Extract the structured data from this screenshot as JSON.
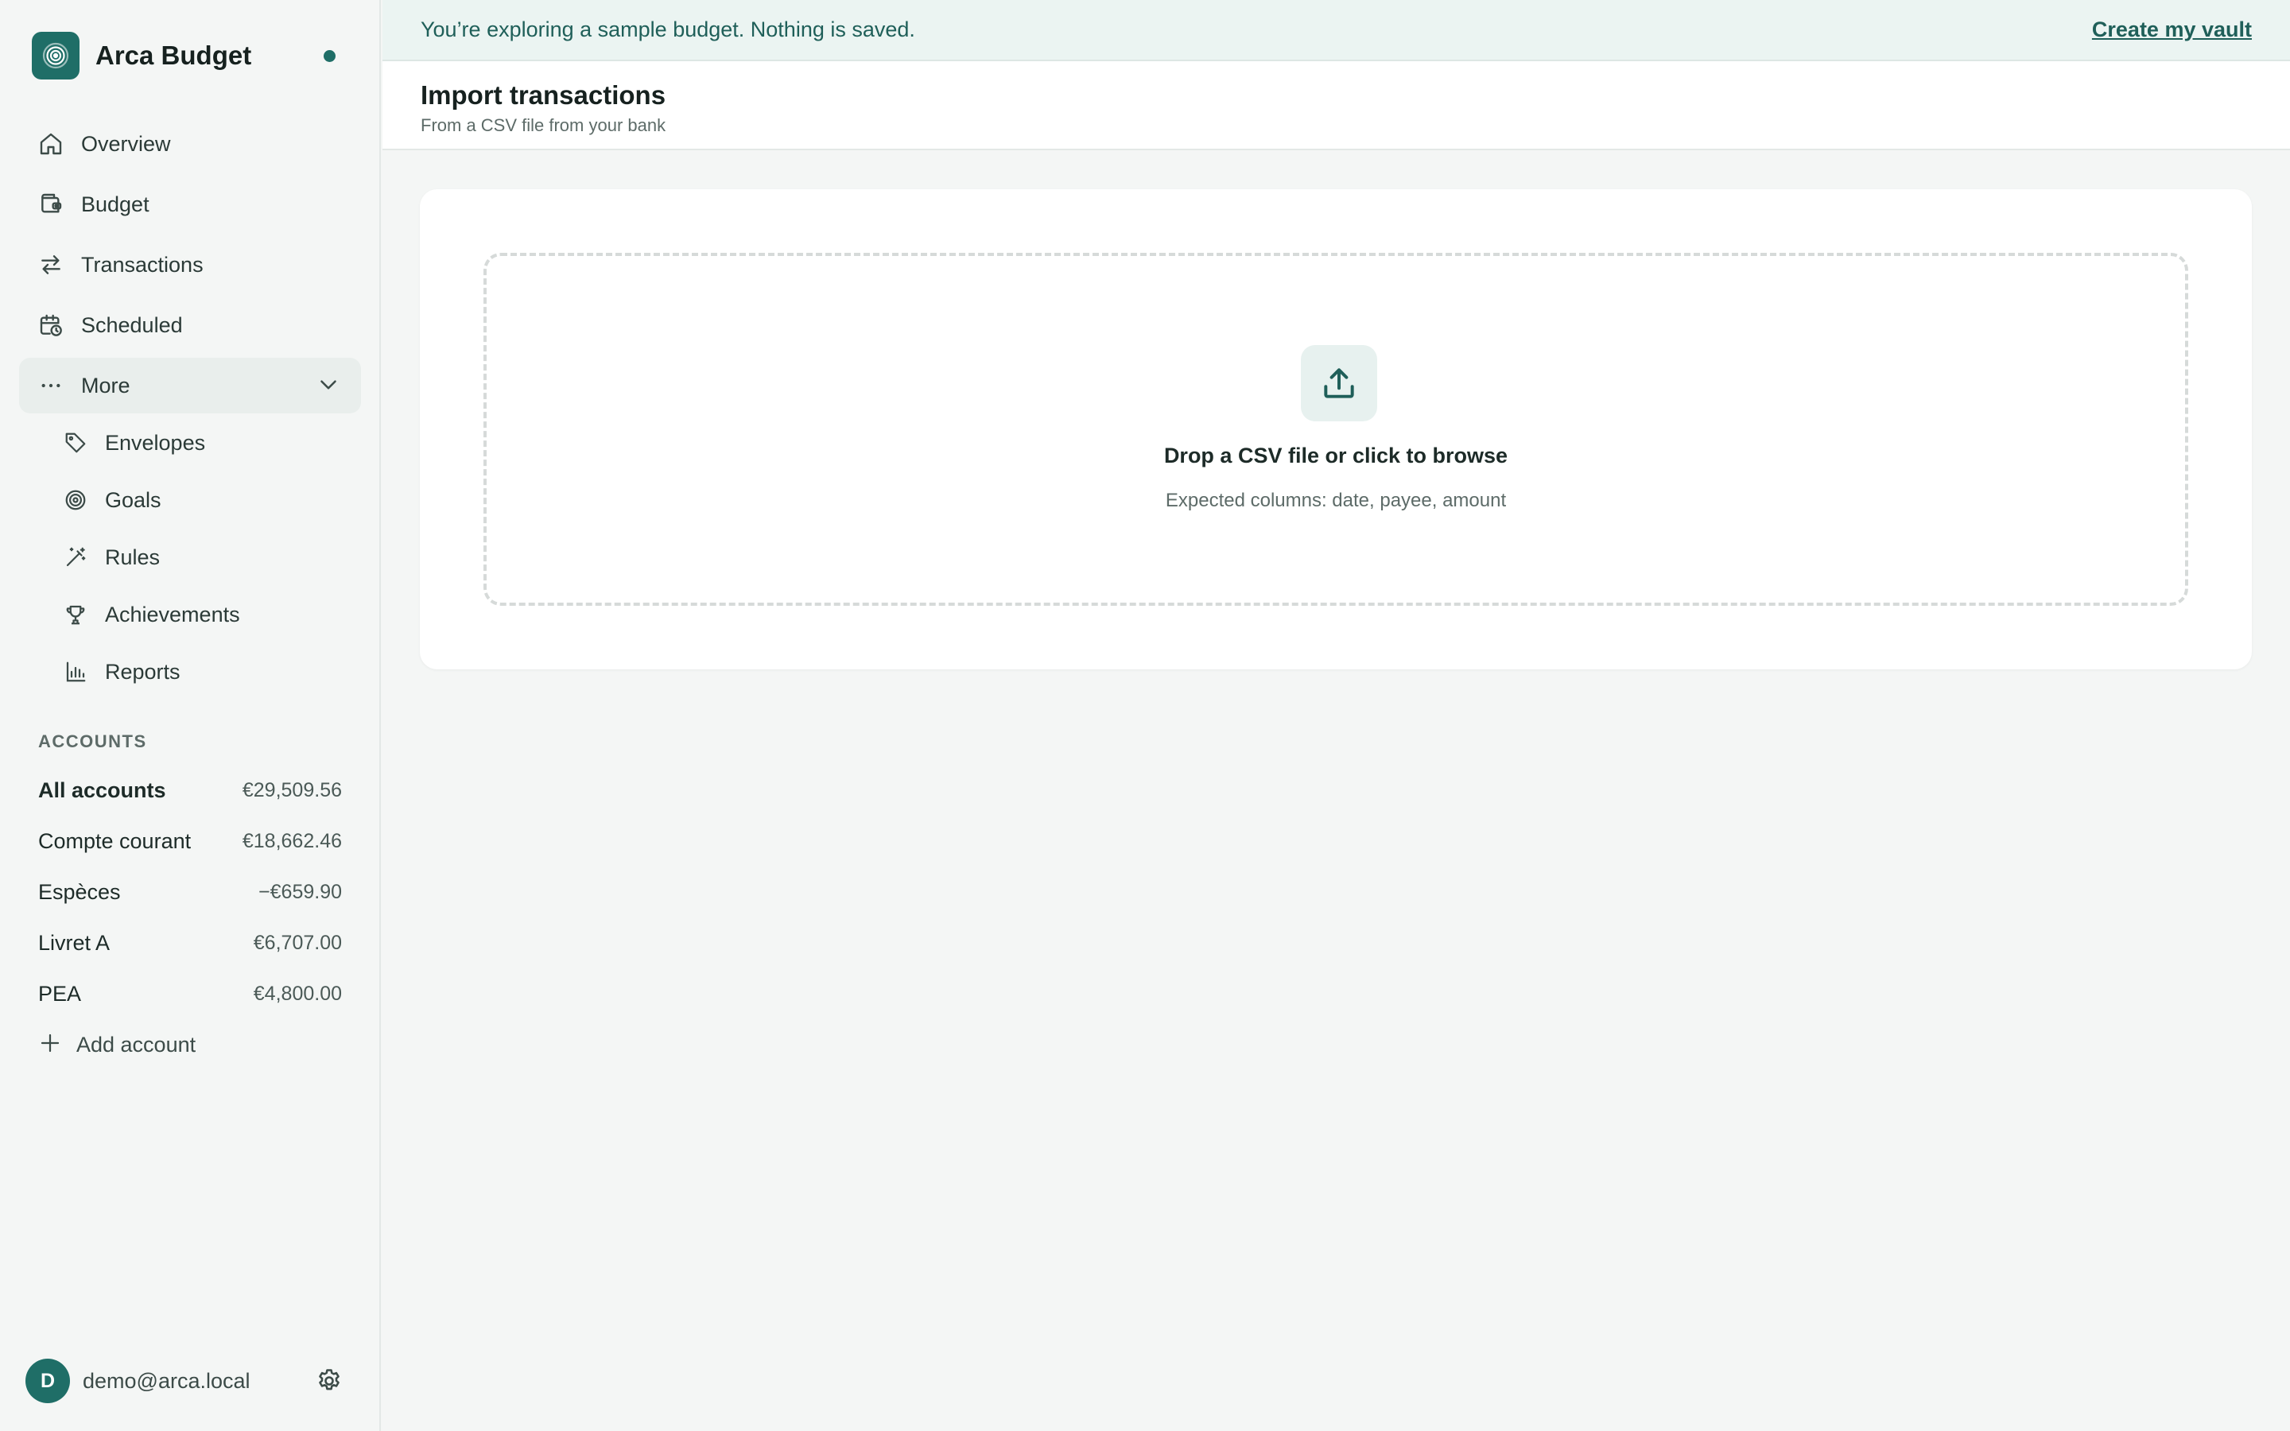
{
  "app": {
    "name": "Arca Budget"
  },
  "nav": {
    "items": [
      {
        "label": "Overview",
        "icon": "home-icon"
      },
      {
        "label": "Budget",
        "icon": "wallet-icon"
      },
      {
        "label": "Transactions",
        "icon": "arrows-swap-icon"
      },
      {
        "label": "Scheduled",
        "icon": "calendar-clock-icon"
      },
      {
        "label": "More",
        "icon": "more-dots-icon"
      }
    ],
    "more_items": [
      {
        "label": "Envelopes",
        "icon": "tag-icon"
      },
      {
        "label": "Goals",
        "icon": "target-icon"
      },
      {
        "label": "Rules",
        "icon": "magic-wand-icon"
      },
      {
        "label": "Achievements",
        "icon": "trophy-icon"
      },
      {
        "label": "Reports",
        "icon": "bar-chart-icon"
      }
    ]
  },
  "accounts": {
    "title": "ACCOUNTS",
    "list": [
      {
        "name": "All accounts",
        "amount": "€29,509.56"
      },
      {
        "name": "Compte courant",
        "amount": "€18,662.46"
      },
      {
        "name": "Espèces",
        "amount": "−€659.90"
      },
      {
        "name": "Livret A",
        "amount": "€6,707.00"
      },
      {
        "name": "PEA",
        "amount": "€4,800.00"
      }
    ],
    "add_label": "Add account"
  },
  "user": {
    "initial": "D",
    "email": "demo@arca.local"
  },
  "banner": {
    "message": "You’re exploring a sample budget. Nothing is saved.",
    "cta": "Create my vault"
  },
  "page": {
    "title": "Import transactions",
    "subtitle": "From a CSV file from your bank"
  },
  "dropzone": {
    "title": "Drop a CSV file or click to browse",
    "subtitle": "Expected columns: date, payee, amount"
  },
  "colors": {
    "accent": "#1f6e67",
    "banner_bg": "#ebf4f2",
    "sidebar_bg": "#f4f6f5"
  }
}
